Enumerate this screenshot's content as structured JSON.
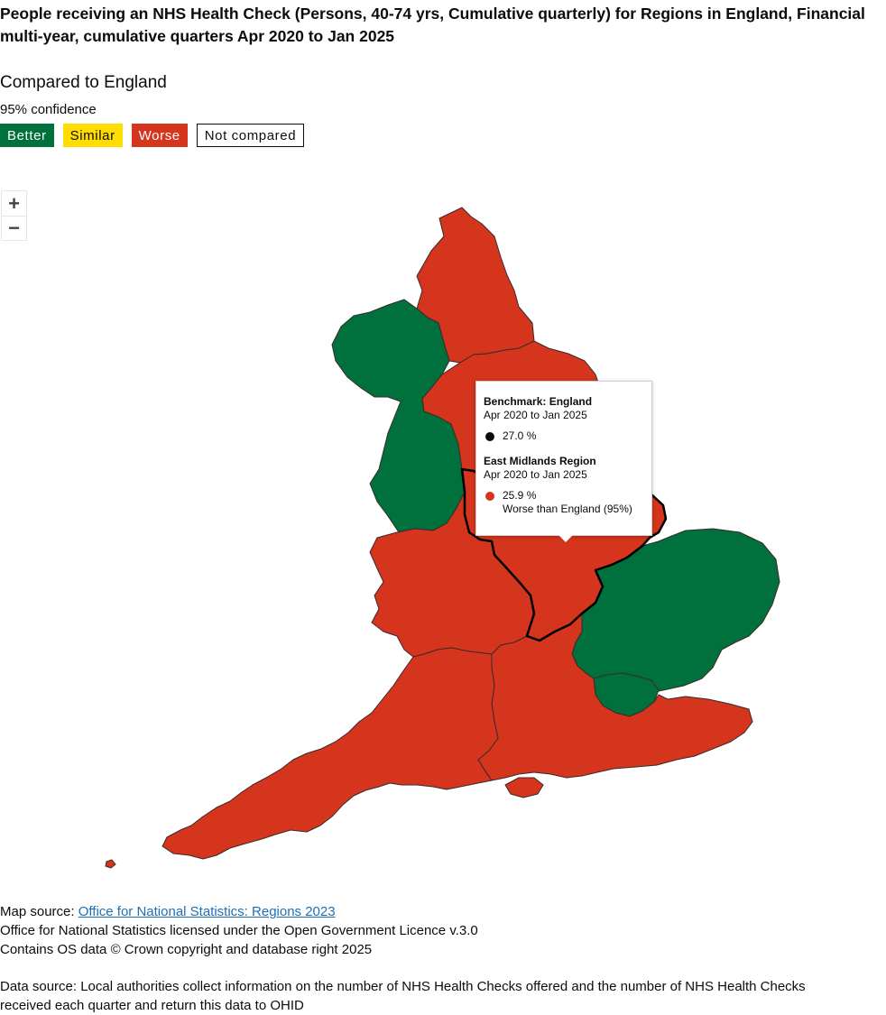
{
  "title": "People receiving an NHS Health Check (Persons, 40-74 yrs, Cumulative quarterly) for Regions in England, Financial multi-year, cumulative quarters Apr 2020 to Jan 2025",
  "legend": {
    "heading": "Compared to England",
    "subheading": "95% confidence",
    "items": [
      {
        "label": "Better",
        "color": "#00703c"
      },
      {
        "label": "Similar",
        "color": "#ffdd00"
      },
      {
        "label": "Worse",
        "color": "#d4351c"
      },
      {
        "label": "Not compared",
        "color": "#ffffff"
      }
    ]
  },
  "zoom": {
    "in_icon": "plus-icon",
    "out_icon": "minus-icon",
    "in_label": "+",
    "out_label": "−"
  },
  "regions": [
    {
      "name": "North East Region",
      "comparison": "Worse",
      "color": "#d4351c"
    },
    {
      "name": "North West Region",
      "comparison": "Better",
      "color": "#00703c"
    },
    {
      "name": "Yorkshire and The Humber Region",
      "comparison": "Worse",
      "color": "#d4351c"
    },
    {
      "name": "East Midlands Region",
      "comparison": "Worse",
      "color": "#d4351c"
    },
    {
      "name": "West Midlands Region",
      "comparison": "Worse",
      "color": "#d4351c"
    },
    {
      "name": "East of England Region",
      "comparison": "Better",
      "color": "#00703c"
    },
    {
      "name": "London Region",
      "comparison": "Better",
      "color": "#00703c"
    },
    {
      "name": "South East Region",
      "comparison": "Worse",
      "color": "#d4351c"
    },
    {
      "name": "South West Region",
      "comparison": "Worse",
      "color": "#d4351c"
    }
  ],
  "tooltip": {
    "benchmark_title": "Benchmark: England",
    "benchmark_period": "Apr 2020 to Jan 2025",
    "benchmark_value": "27.0 %",
    "benchmark_color": "#0b0c0c",
    "area_title": "East Midlands Region",
    "area_period": "Apr 2020 to Jan 2025",
    "area_value": "25.9 %",
    "area_comparison": "Worse than England (95%)",
    "area_color": "#d4351c"
  },
  "footer": {
    "map_source_prefix": "Map source: ",
    "map_source_link": "Office for National Statistics: Regions 2023",
    "licence": "Office for National Statistics licensed under the Open Government Licence v.3.0",
    "os_data": "Contains OS data © Crown copyright and database right 2025",
    "data_source": "Data source: Local authorities collect information on the number of NHS Health Checks offered and the number of NHS Health Checks received each quarter and return this data to OHID"
  }
}
